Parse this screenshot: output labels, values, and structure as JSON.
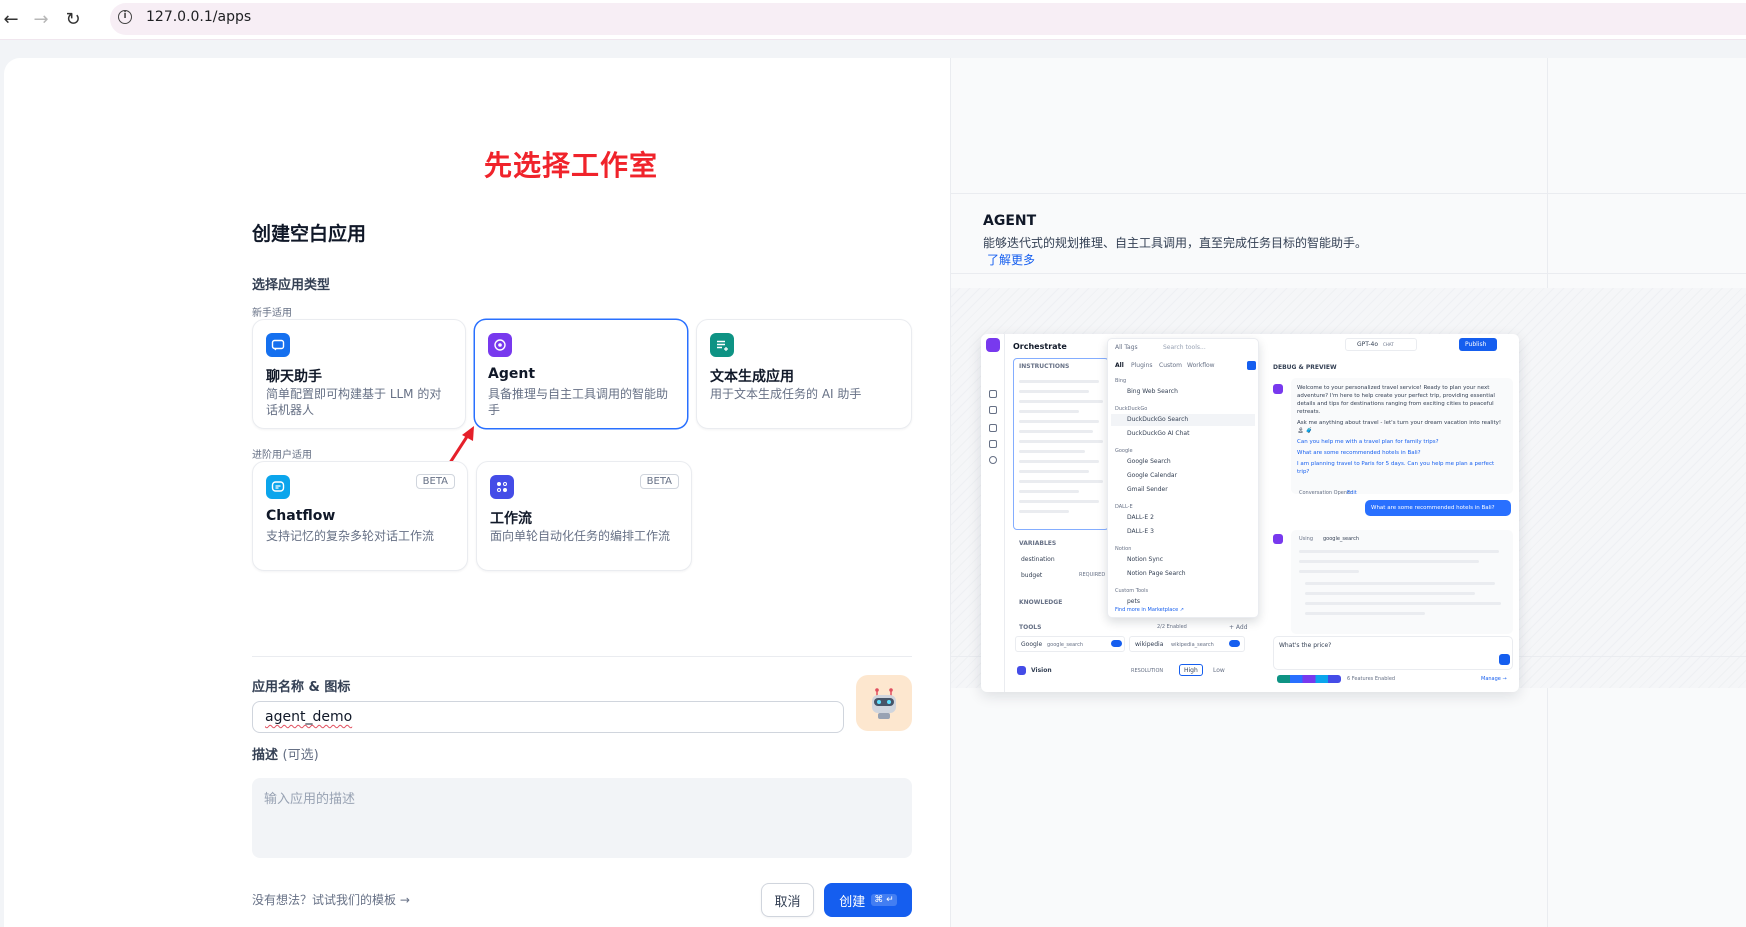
{
  "browser": {
    "url": "127.0.0.1/apps"
  },
  "annotation": "先选择工作室",
  "dialog": {
    "title": "创建空白应用",
    "type_section_label": "选择应用类型",
    "beginner_label": "新手适用",
    "advanced_label": "进阶用户适用",
    "app_types": [
      {
        "name": "聊天助手",
        "desc": "简单配置即可构建基于 LLM 的对话机器人",
        "color": "#1570ef",
        "icon": "chat-bubble-icon"
      },
      {
        "name": "Agent",
        "desc": "具备推理与自主工具调用的智能助手",
        "color": "#7839ee",
        "icon": "robot-icon"
      },
      {
        "name": "文本生成应用",
        "desc": "用于文本生成任务的 AI 助手",
        "color": "#0e9384",
        "icon": "text-generate-icon"
      },
      {
        "name": "Chatflow",
        "desc": "支持记忆的复杂多轮对话工作流",
        "color": "#0ba5ec",
        "icon": "chatflow-icon",
        "badge": "BETA"
      },
      {
        "name": "工作流",
        "desc": "面向单轮自动化任务的编排工作流",
        "color": "#444ce7",
        "icon": "workflow-icon",
        "badge": "BETA"
      }
    ],
    "name_label": "应用名称 & 图标",
    "name_value": "agent_demo",
    "desc_label": "描述",
    "desc_optional": "(可选)",
    "desc_placeholder": "输入应用的描述",
    "template_link": "没有想法？试试我们的模板",
    "cancel_label": "取消",
    "create_label": "创建",
    "create_shortcut": "⌘ ↵"
  },
  "preview_panel": {
    "title": "AGENT",
    "desc": "能够迭代式的规划推理、自主工具调用，直至完成任务目标的智能助手。",
    "learn_more": "了解更多",
    "mock": {
      "orchestrate": "Orchestrate",
      "instructions": "INSTRUCTIONS",
      "variables": "VARIABLES",
      "var1": "destination",
      "var2": "budget",
      "required": "REQUIRED",
      "knowledge": "KNOWLEDGE",
      "tools": "TOOLS",
      "tools_enabled": "2/2 Enabled",
      "add": "+ Add",
      "tool1": "Google",
      "tool1_sub": "google_search",
      "tool2": "wikipedia",
      "tool2_sub": "wikipedia_search",
      "vision": "Vision",
      "resolution": "RESOLUTION",
      "high": "High",
      "low": "Low",
      "all_tags": "All Tags",
      "search_tools": "Search tools...",
      "tabs": [
        "All",
        "Plugins",
        "Custom",
        "Workflow"
      ],
      "tool_groups": [
        {
          "group": "Bing",
          "items": [
            "Bing Web Search"
          ]
        },
        {
          "group": "DuckDuckGo",
          "items": [
            "DuckDuckGo Search",
            "DuckDuckGo AI Chat"
          ]
        },
        {
          "group": "Google",
          "items": [
            "Google Search",
            "Google Calendar",
            "Gmail Sender"
          ]
        },
        {
          "group": "DALL-E",
          "items": [
            "DALL-E 2",
            "DALL-E 3"
          ]
        },
        {
          "group": "Notion",
          "items": [
            "Notion Sync",
            "Notion Page Search"
          ]
        },
        {
          "group": "Custom Tools",
          "items": [
            "pets"
          ]
        }
      ],
      "find_more": "Find more in Marketplace ↗",
      "model": "GPT-4o",
      "chat_badge": "CHAT",
      "publish": "Publish",
      "debug_preview": "DEBUG & PREVIEW",
      "welcome": "Welcome to your personalized travel service! Ready to plan your next adventure? I'm here to help create your perfect trip, providing essential details and tips for destinations ranging from exciting cities to peaceful retreats.",
      "ask": "Ask me anything about travel - let's turn your dream vacation into reality! 🏝 🧳",
      "suggestions": [
        "Can you help me with a travel plan for family trips?",
        "What are some recommended hotels in Bali?",
        "I am planning travel to Paris for 5 days. Can you help me plan a perfect trip?"
      ],
      "opener": "Conversation Opener",
      "edit": "Edit",
      "user_msg": "What are some recommended hotels in Bali?",
      "using": "Using",
      "using_tool": "google_search",
      "input": "What's the price?",
      "features": "6 Features Enabled",
      "manage": "Manage →"
    }
  }
}
